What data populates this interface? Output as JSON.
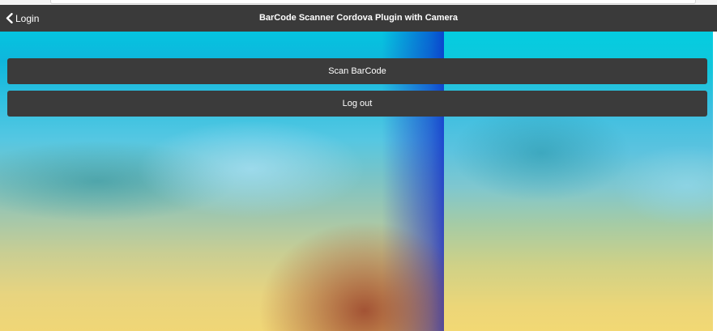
{
  "navbar": {
    "back_label": "Login",
    "title": "BarCode Scanner Cordova Plugin with Camera",
    "background": "#3a3a3a"
  },
  "actions": {
    "scan_label": "Scan BarCode",
    "logout_label": "Log out",
    "button_color": "#3b3b3b"
  },
  "icons": {
    "back": "chevron-left-icon"
  }
}
